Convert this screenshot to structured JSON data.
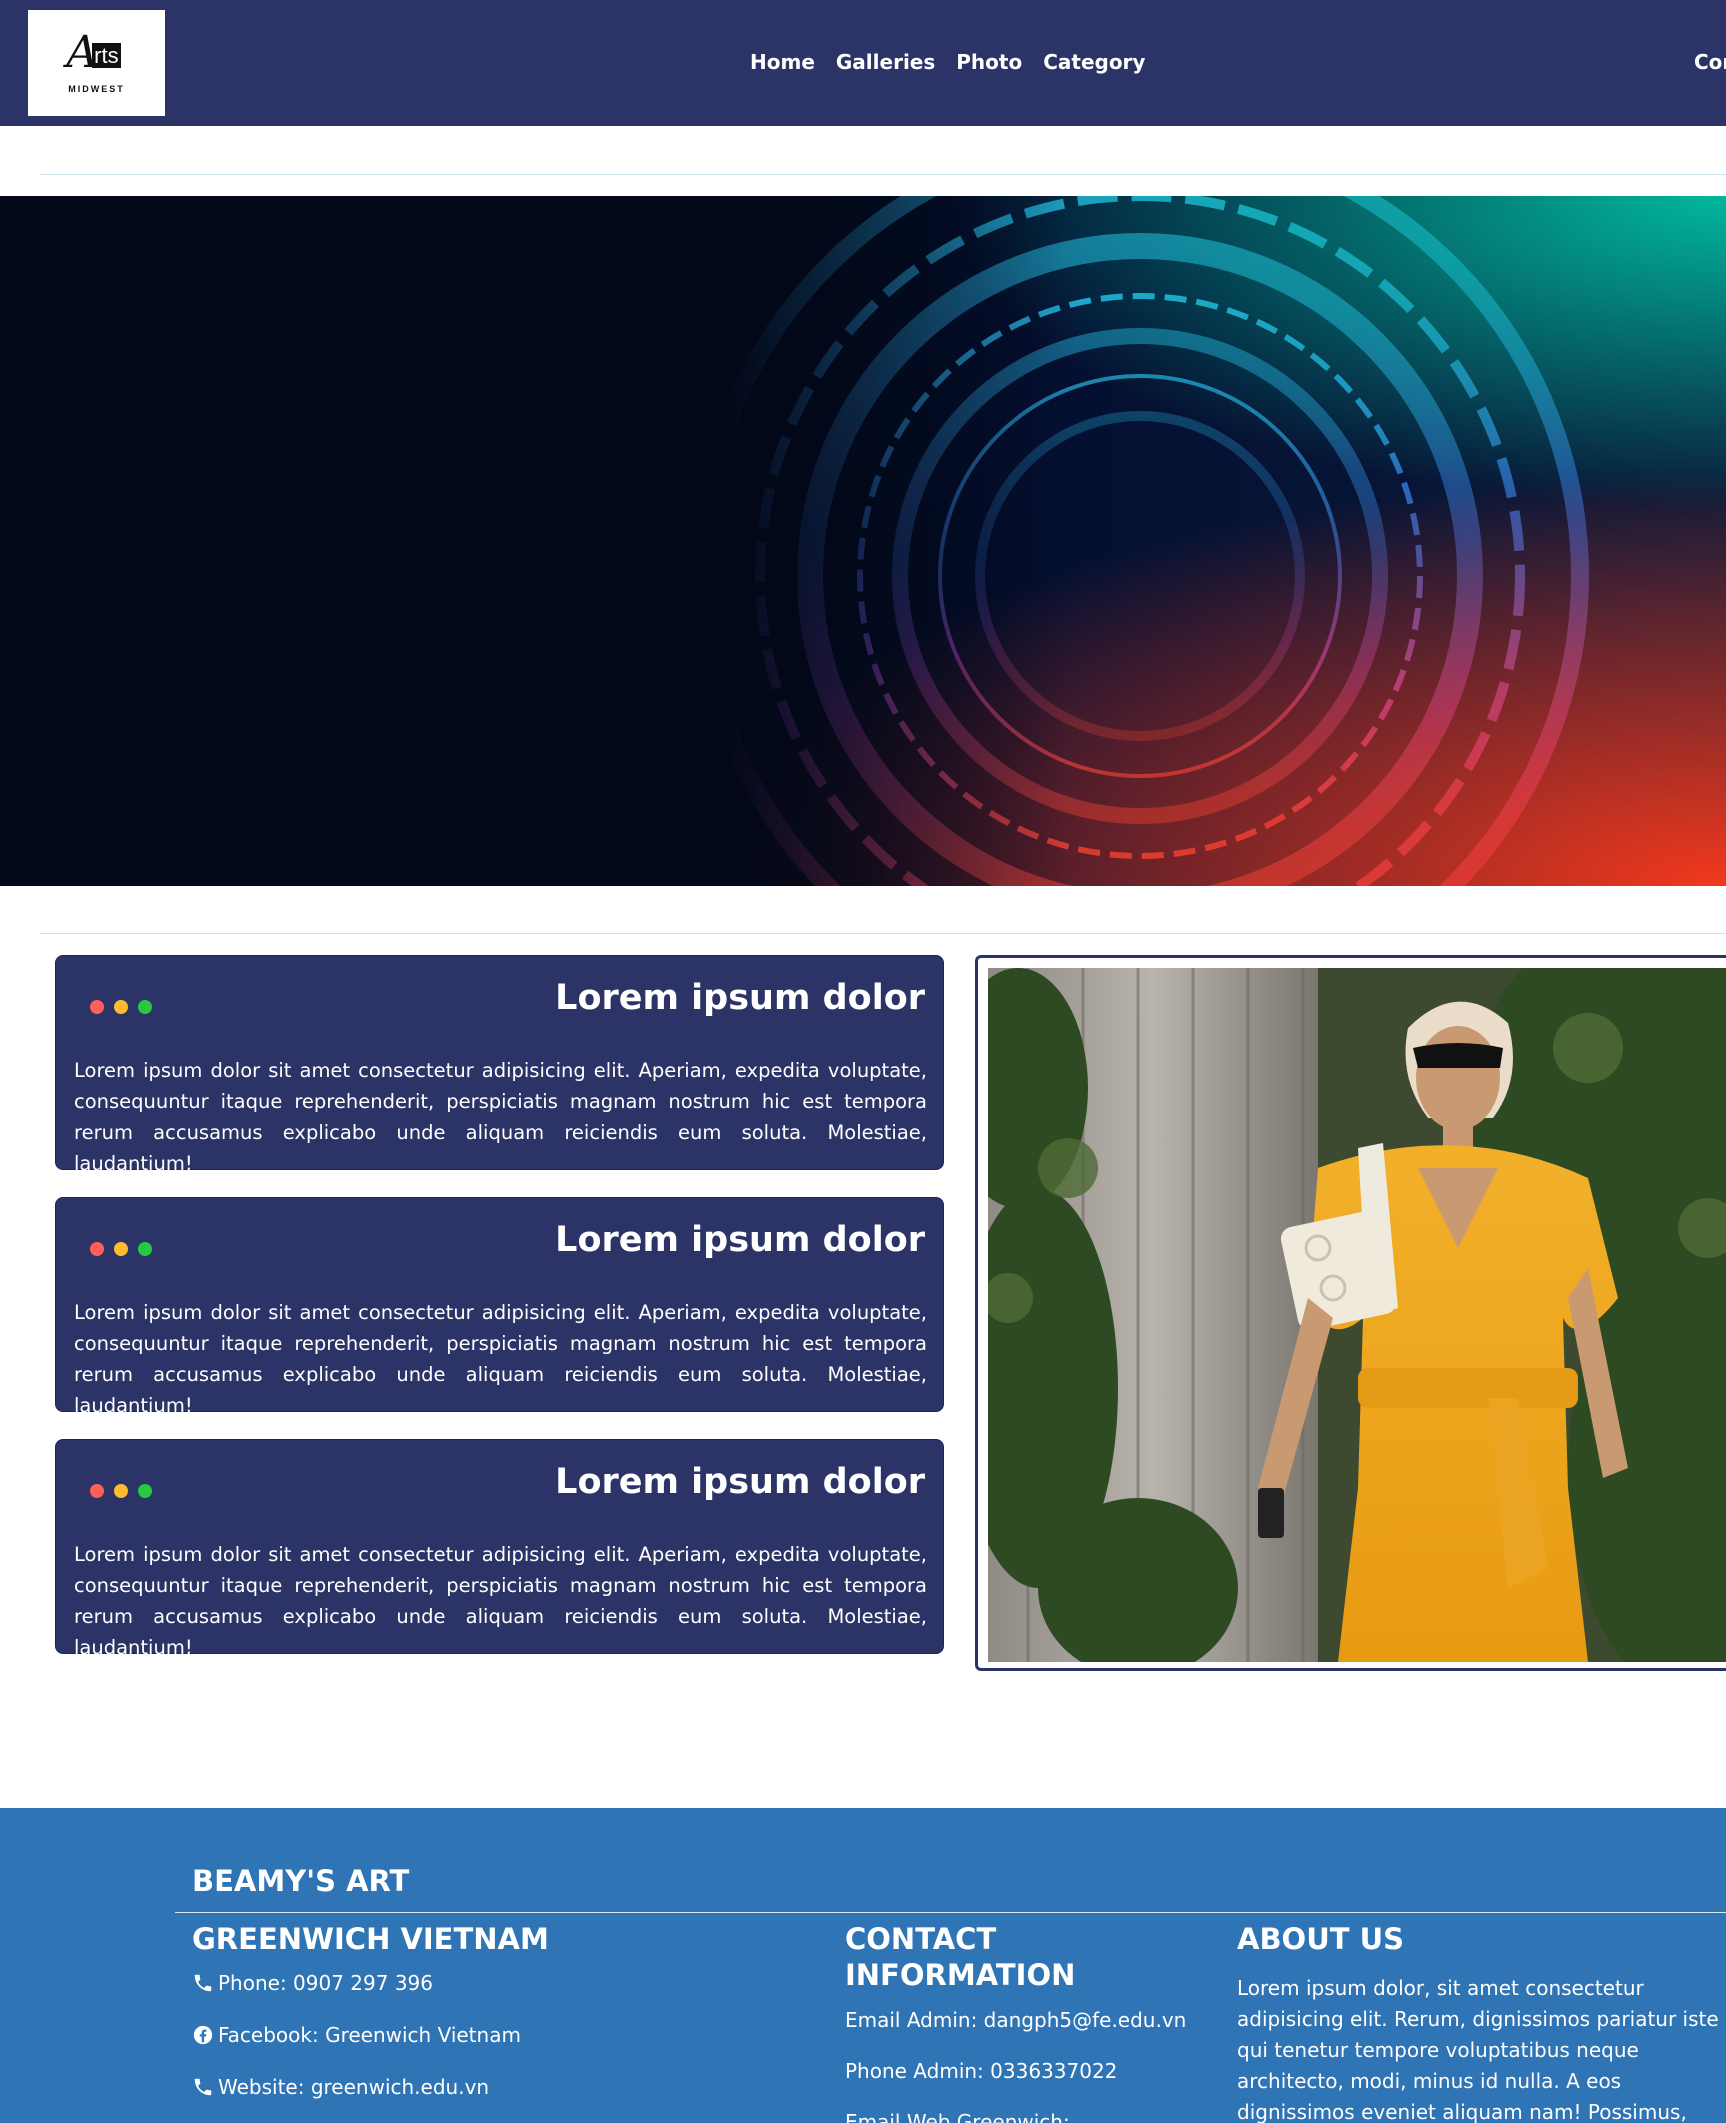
{
  "header": {
    "logo_text": "Arts",
    "logo_sub": "MIDWEST",
    "nav": [
      "Home",
      "Galleries",
      "Photo",
      "Category"
    ],
    "nav_right": "Cor"
  },
  "cards": [
    {
      "title": "Lorem ipsum dolor",
      "text": "Lorem ipsum dolor sit amet consectetur adipisicing elit. Aperiam, expedita voluptate, consequuntur itaque reprehenderit, perspiciatis magnam nostrum hic est tempora rerum accusamus explicabo unde aliquam reiciendis eum soluta. Molestiae, laudantium!"
    },
    {
      "title": "Lorem ipsum dolor",
      "text": "Lorem ipsum dolor sit amet consectetur adipisicing elit. Aperiam, expedita voluptate, consequuntur itaque reprehenderit, perspiciatis magnam nostrum hic est tempora rerum accusamus explicabo unde aliquam reiciendis eum soluta. Molestiae, laudantium!"
    },
    {
      "title": "Lorem ipsum dolor",
      "text": "Lorem ipsum dolor sit amet consectetur adipisicing elit. Aperiam, expedita voluptate, consequuntur itaque reprehenderit, perspiciatis magnam nostrum hic est tempora rerum accusamus explicabo unde aliquam reiciendis eum soluta. Molestiae, laudantium!"
    }
  ],
  "footer": {
    "brand": "BEAMY'S ART",
    "col1": {
      "title": "GREENWICH VIETNAM",
      "phone": "Phone: 0907 297 396",
      "facebook": "Facebook: Greenwich Vietnam",
      "website": "Website: greenwich.edu.vn"
    },
    "col2": {
      "title_line1": "CONTACT",
      "title_line2": "INFORMATION",
      "email": "Email Admin: dangph5@fe.edu.vn",
      "phone": "Phone Admin: 0336337022",
      "partial": "Email Web Greenwich: ..."
    },
    "col3": {
      "title": "ABOUT US",
      "text": "Lorem ipsum dolor, sit amet consectetur adipisicing elit. Rerum, dignissimos pariatur iste qui tenetur tempore voluptatibus neque architecto, modi, minus id nulla. A eos dignissimos eveniet aliquam nam! Possimus, dignissimos?"
    }
  },
  "colors": {
    "navbar": "#2c3467",
    "card": "#2c3467",
    "footer": "#2f74b5",
    "dot_red": "#ff5f57",
    "dot_yellow": "#febc2e",
    "dot_green": "#28c840"
  },
  "icons": [
    "phone-icon",
    "facebook-icon",
    "globe-phone-icon"
  ]
}
